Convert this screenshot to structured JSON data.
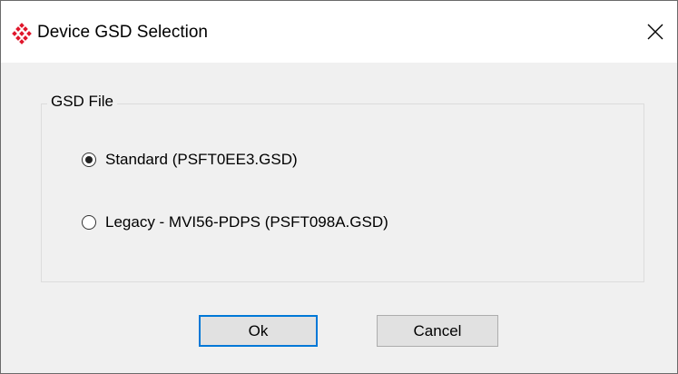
{
  "window": {
    "title": "Device GSD Selection",
    "icon": "app-diamond-icon",
    "close_icon": "close-icon"
  },
  "group": {
    "legend": "GSD File",
    "options": [
      {
        "label": "Standard (PSFT0EE3.GSD)",
        "selected": true
      },
      {
        "label": "Legacy - MVI56-PDPS (PSFT098A.GSD)",
        "selected": false
      }
    ]
  },
  "buttons": {
    "ok_label": "Ok",
    "cancel_label": "Cancel"
  },
  "colors": {
    "brand_icon": "#e0162b",
    "focus_border": "#0078d7",
    "dialog_bg": "#f0f0f0",
    "titlebar_bg": "#ffffff"
  }
}
